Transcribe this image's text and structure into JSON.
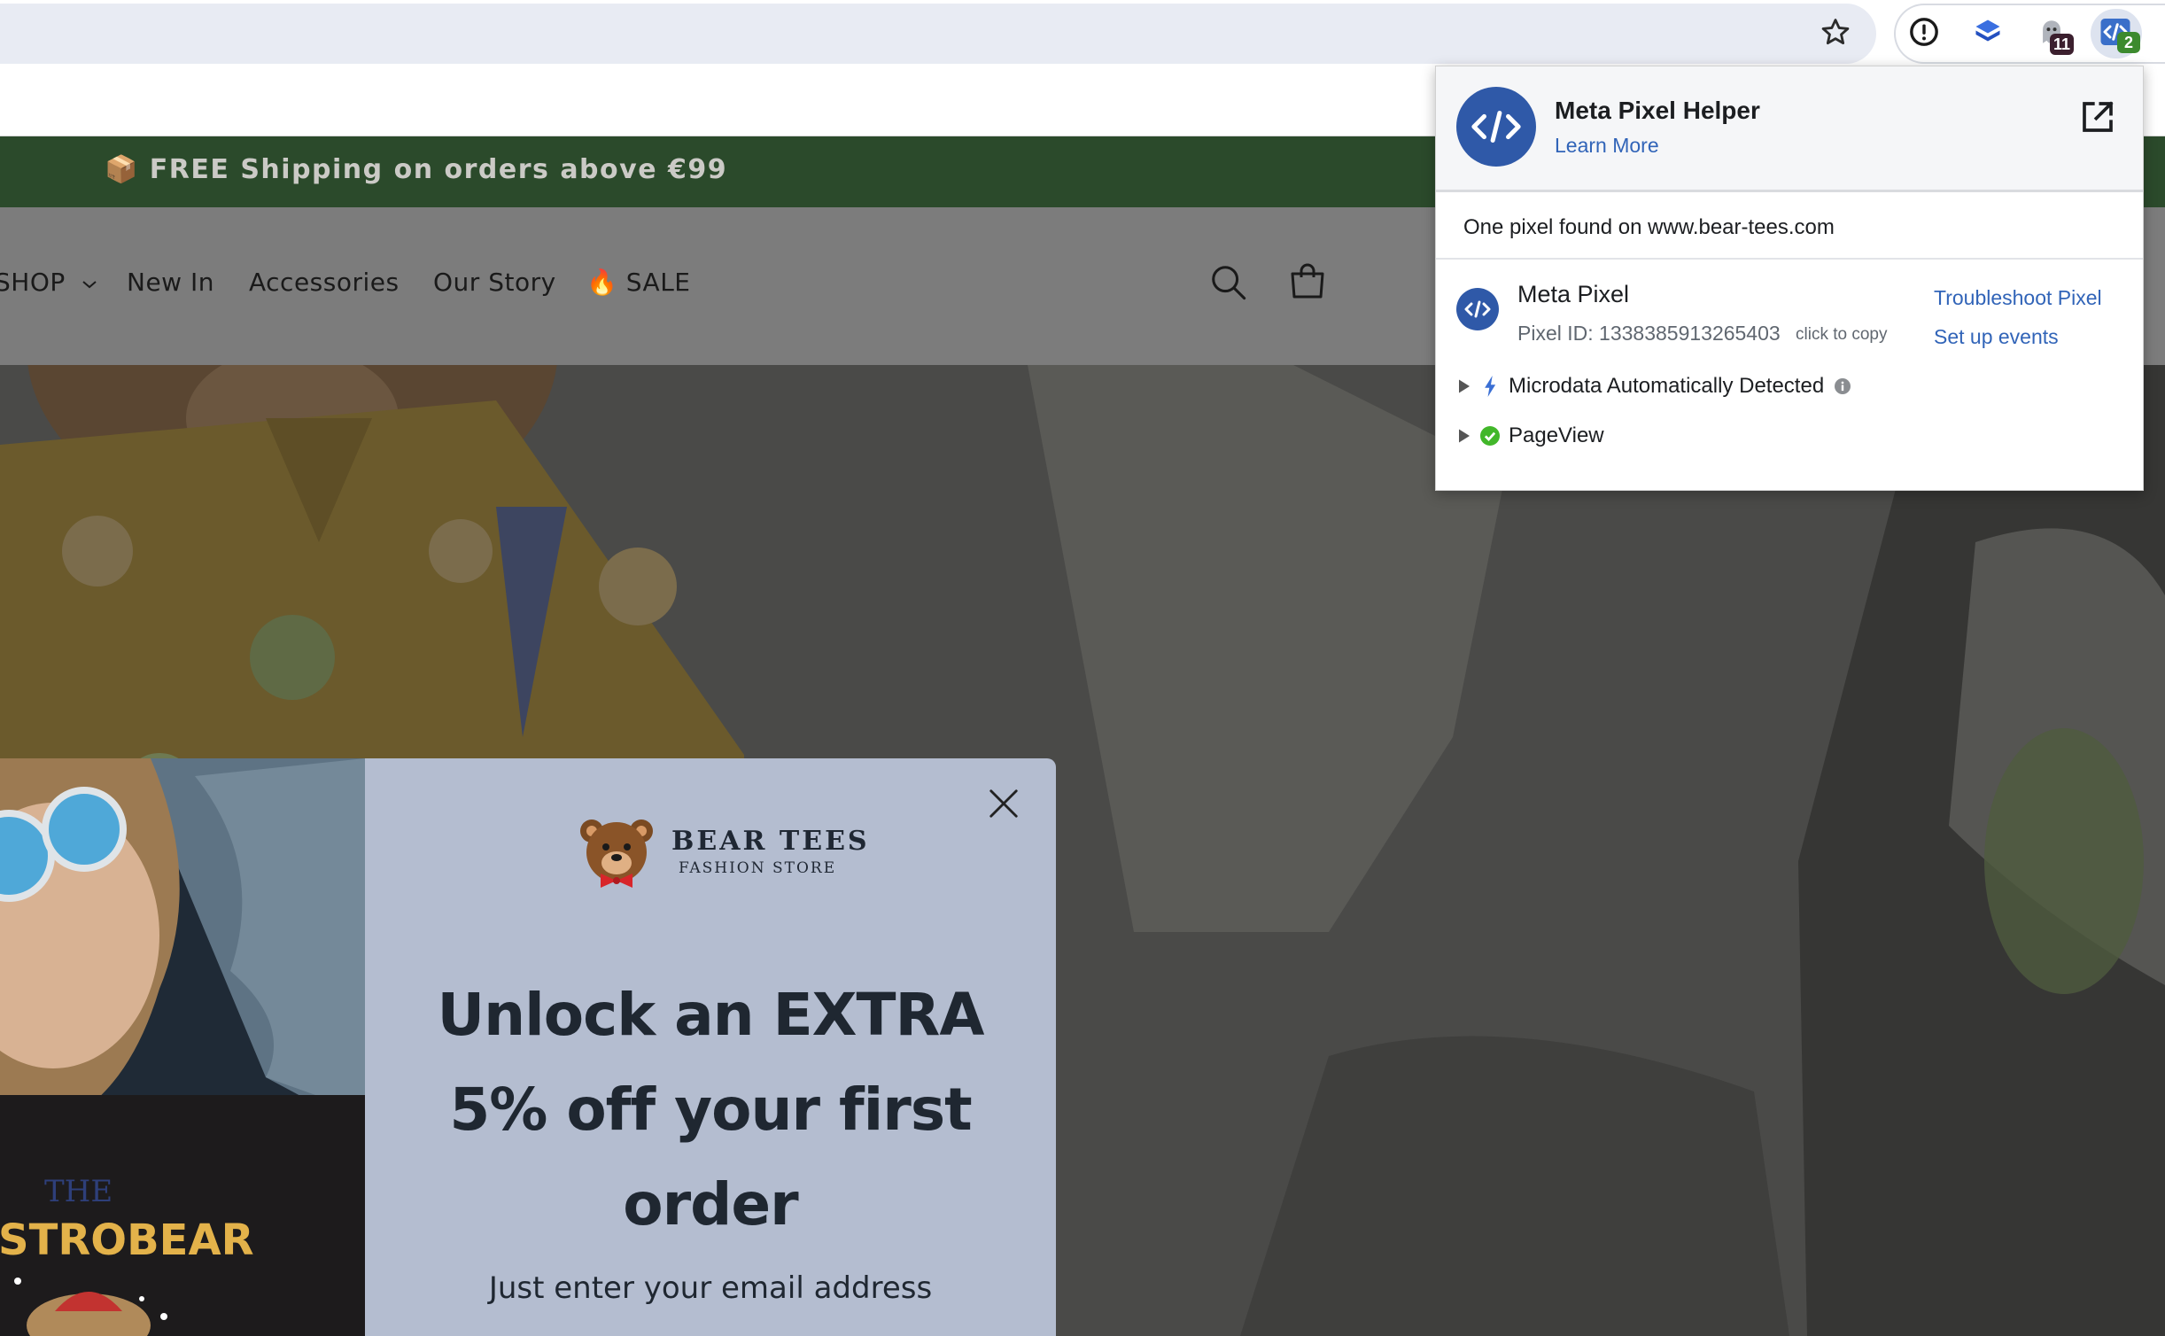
{
  "browser": {
    "toolbar": {
      "bookmark_icon": "star-icon",
      "extensions": [
        {
          "name": "password-manager",
          "icon": "password-manager-icon",
          "badge": ""
        },
        {
          "name": "shield-extension",
          "icon": "blue-cube-icon",
          "badge": ""
        },
        {
          "name": "ghost-extension",
          "icon": "ghost-icon",
          "badge": "11"
        },
        {
          "name": "meta-pixel-helper",
          "icon": "code-brackets-icon",
          "badge": "2"
        }
      ]
    }
  },
  "store": {
    "announcement": "📦 FREE Shipping on orders above €99",
    "nav": {
      "shop": "SHOP",
      "new_in": "New In",
      "accessories": "Accessories",
      "our_story": "Our Story",
      "sale": "🔥 SALE"
    }
  },
  "newsletter_popup": {
    "brand_name": "BEAR TEES",
    "brand_sub": "FASHION STORE",
    "image_text_the": "THE",
    "image_text_name": "STROBEAR",
    "heading_line1": "Unlock an EXTRA",
    "heading_line2": "5% off your first",
    "heading_line3": "order",
    "subtext": "Just enter your email address"
  },
  "pixel_helper": {
    "title": "Meta Pixel Helper",
    "learn_more": "Learn More",
    "summary": "One pixel found on www.bear-tees.com",
    "pixel": {
      "name": "Meta Pixel",
      "id_label": "Pixel ID: 1338385913265403",
      "copy_hint": "click to copy",
      "troubleshoot": "Troubleshoot Pixel",
      "setup_events": "Set up events"
    },
    "events": [
      {
        "label": "Microdata Automatically Detected",
        "status": "warning"
      },
      {
        "label": "PageView",
        "status": "success"
      }
    ],
    "colors": {
      "accent": "#3164b8",
      "brand_blue": "#2f59a8",
      "success": "#42b72a"
    }
  }
}
